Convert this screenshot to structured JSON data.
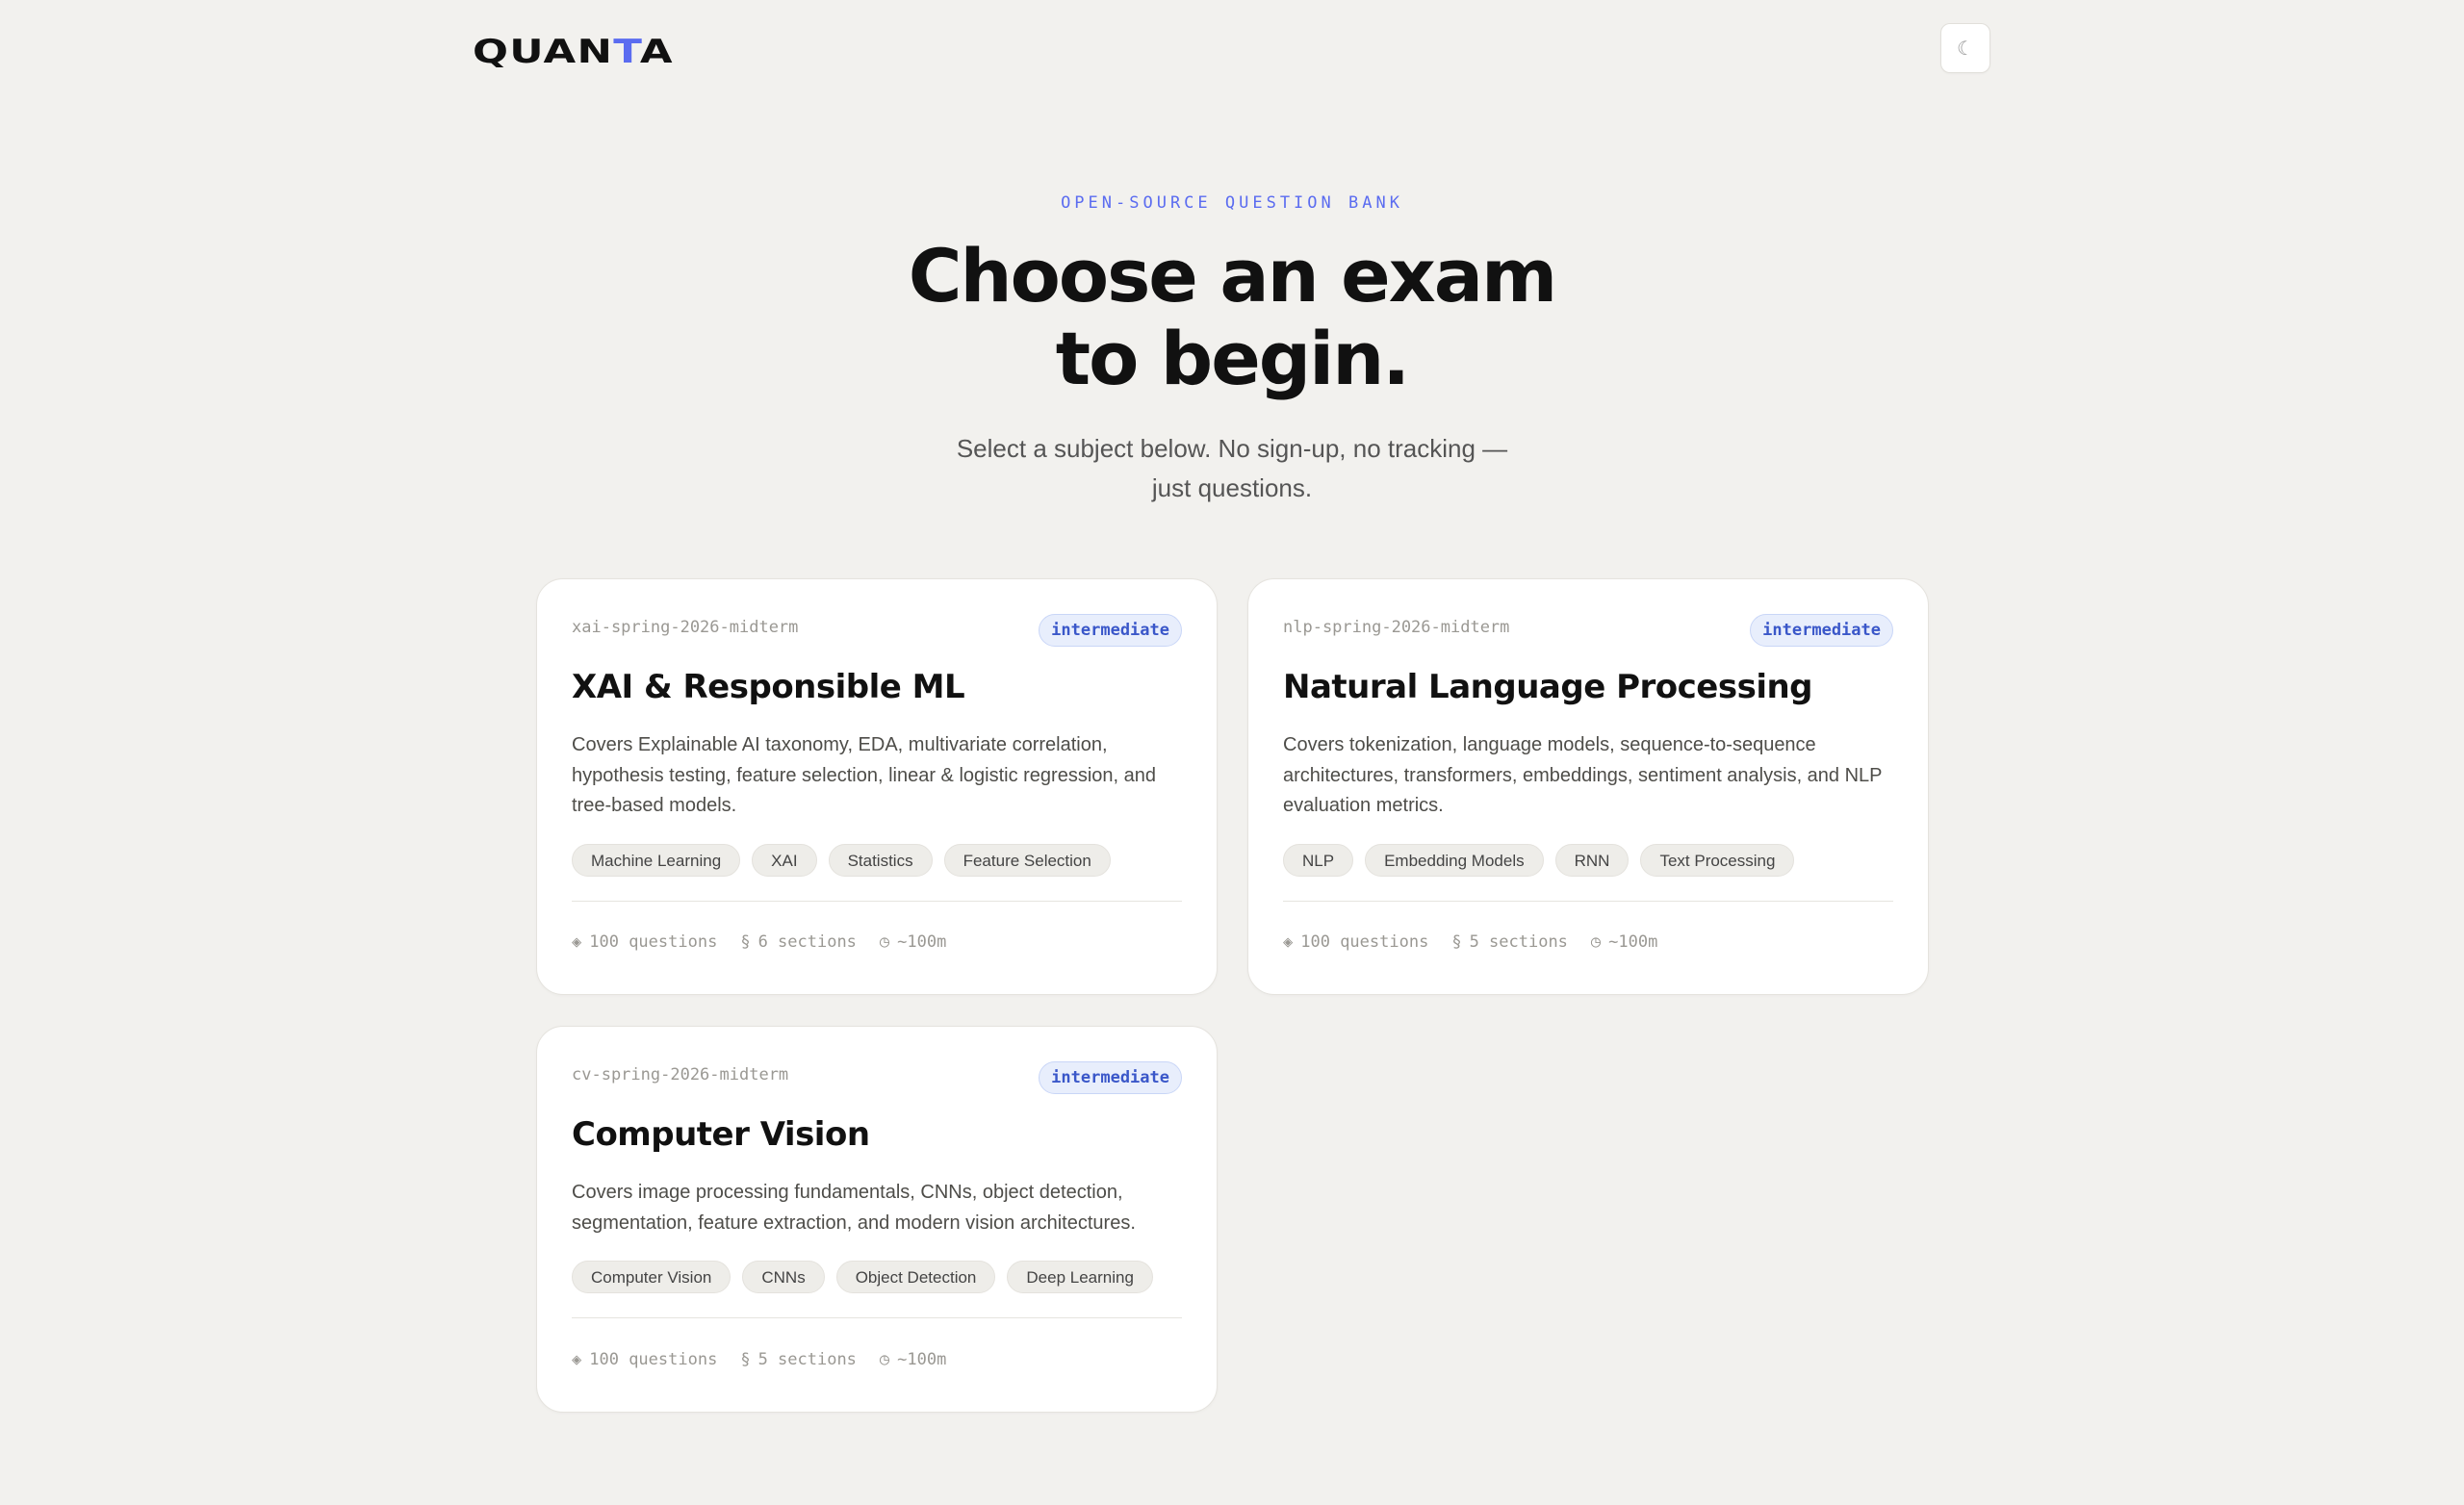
{
  "app": {
    "logo": {
      "prefix": "QUAN",
      "accent": "T",
      "suffix": "A"
    },
    "theme_toggle_glyph": "☾",
    "accent_color": "#5b6cf0"
  },
  "hero": {
    "eyebrow": "OPEN-SOURCE QUESTION BANK",
    "headline_line1": "Choose an exam",
    "headline_line2": "to begin.",
    "subtitle_line1": "Select a subject below. No sign-up, no tracking —",
    "subtitle_line2": "just questions."
  },
  "exams": [
    {
      "slug": "xai-spring-2026-midterm",
      "level": "intermediate",
      "title": "XAI & Responsible ML",
      "description": "Covers Explainable AI taxonomy, EDA, multivariate correlation, hypothesis testing, feature selection, linear & logistic regression, and tree-based models.",
      "tags": [
        "Machine Learning",
        "XAI",
        "Statistics",
        "Feature Selection"
      ],
      "questions": "100 questions",
      "sections": "6 sections",
      "duration": "~100m"
    },
    {
      "slug": "nlp-spring-2026-midterm",
      "level": "intermediate",
      "title": "Natural Language Processing",
      "description": "Covers tokenization, language models, sequence-to-sequence architectures, transformers, embeddings, sentiment analysis, and NLP evaluation metrics.",
      "tags": [
        "NLP",
        "Embedding Models",
        "RNN",
        "Text Processing"
      ],
      "questions": "100 questions",
      "sections": "5 sections",
      "duration": "~100m"
    },
    {
      "slug": "cv-spring-2026-midterm",
      "level": "intermediate",
      "title": "Computer Vision",
      "description": "Covers image processing fundamentals, CNNs, object detection, segmentation, feature extraction, and modern vision architectures.",
      "tags": [
        "Computer Vision",
        "CNNs",
        "Object Detection",
        "Deep Learning"
      ],
      "questions": "100 questions",
      "sections": "5 sections",
      "duration": "~100m"
    }
  ],
  "icons": {
    "questions": "◈",
    "sections": "§",
    "duration": "◷"
  }
}
